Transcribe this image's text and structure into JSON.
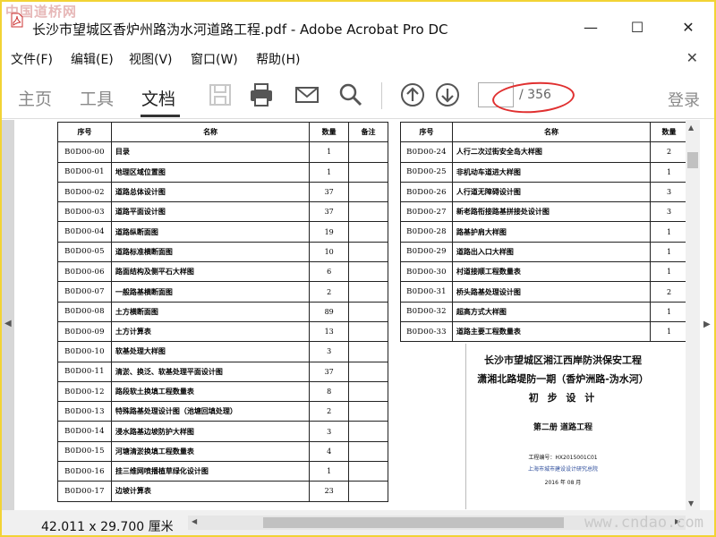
{
  "watermarks": {
    "top": "中国道桥网",
    "bottom": "www.cndao.com"
  },
  "window": {
    "title": "长沙市望城区香炉州路沩水河道路工程.pdf - Adobe Acrobat Pro DC",
    "minimize": "—",
    "maximize": "☐",
    "close": "✕"
  },
  "menu": {
    "items": [
      "文件(F)",
      "编辑(E)",
      "视图(V)",
      "窗口(W)",
      "帮助(H)"
    ],
    "close": "✕"
  },
  "toolbar": {
    "tabs": [
      "主页",
      "工具",
      "文档"
    ],
    "active_tab": "文档",
    "icons": [
      "save-icon",
      "print-icon",
      "email-icon",
      "search-icon",
      "page-up-icon",
      "page-down-icon"
    ],
    "page_value": "",
    "page_total": "/ 356",
    "login": "登录"
  },
  "document": {
    "left_table": {
      "headers": [
        "序号",
        "名称",
        "数量",
        "备注"
      ],
      "rows": [
        {
          "code": "B0D00-00",
          "name": "目录",
          "qty": "1"
        },
        {
          "code": "B0D00-01",
          "name": "地理区域位置图",
          "qty": "1"
        },
        {
          "code": "B0D00-02",
          "name": "道路总体设计图",
          "qty": "37"
        },
        {
          "code": "B0D00-03",
          "name": "道路平面设计图",
          "qty": "37"
        },
        {
          "code": "B0D00-04",
          "name": "道路纵断面图",
          "qty": "19"
        },
        {
          "code": "B0D00-05",
          "name": "道路标准横断面图",
          "qty": "10"
        },
        {
          "code": "B0D00-06",
          "name": "路面结构及侧平石大样图",
          "qty": "6"
        },
        {
          "code": "B0D00-07",
          "name": "一般路基横断面图",
          "qty": "2"
        },
        {
          "code": "B0D00-08",
          "name": "土方横断面图",
          "qty": "89"
        },
        {
          "code": "B0D00-09",
          "name": "土方计算表",
          "qty": "13"
        },
        {
          "code": "B0D00-10",
          "name": "软基处理大样图",
          "qty": "3"
        },
        {
          "code": "B0D00-11",
          "name": "清淤、换泛、软基处理平面设计图",
          "qty": "37"
        },
        {
          "code": "B0D00-12",
          "name": "路段软土换填工程数量表",
          "qty": "8"
        },
        {
          "code": "B0D00-13",
          "name": "特殊路基处理设计图（池塘回填处理）",
          "qty": "2"
        },
        {
          "code": "B0D00-14",
          "name": "浸水路基边坡防护大样图",
          "qty": "3"
        },
        {
          "code": "B0D00-15",
          "name": "河塘清淤换填工程数量表",
          "qty": "4"
        },
        {
          "code": "B0D00-16",
          "name": "挂三维网喷播植草绿化设计图",
          "qty": "1"
        },
        {
          "code": "B0D00-17",
          "name": "边坡计算表",
          "qty": "23"
        }
      ]
    },
    "right_table": {
      "headers": [
        "序号",
        "名称",
        "数量"
      ],
      "rows": [
        {
          "code": "B0D00-24",
          "name": "人行二次过街安全岛大样图",
          "qty": "2"
        },
        {
          "code": "B0D00-25",
          "name": "非机动车道进大样图",
          "qty": "1"
        },
        {
          "code": "B0D00-26",
          "name": "人行道无障碍设计图",
          "qty": "3"
        },
        {
          "code": "B0D00-27",
          "name": "新老路衔接路基拼接处设计图",
          "qty": "3"
        },
        {
          "code": "B0D00-28",
          "name": "路基护肩大样图",
          "qty": "1"
        },
        {
          "code": "B0D00-29",
          "name": "道路出入口大样图",
          "qty": "1"
        },
        {
          "code": "B0D00-30",
          "name": "村道接顺工程数量表",
          "qty": "1"
        },
        {
          "code": "B0D00-31",
          "name": "桥头路基处理设计图",
          "qty": "2"
        },
        {
          "code": "B0D00-32",
          "name": "超高方式大样图",
          "qty": "1"
        },
        {
          "code": "B0D00-33",
          "name": "道路主要工程数量表",
          "qty": "1"
        }
      ]
    },
    "cover": {
      "line1": "长沙市望城区湘江西岸防洪保安工程",
      "line2": "潇湘北路堤防一期（香炉洲路-沩水河）",
      "line3": "初 步 设 计",
      "line4": "第二册  道路工程",
      "line5": "工程编号：HX2015001C01",
      "line6": "上海市城市建设设计研究总院",
      "line7": "2016 年 08 月"
    }
  },
  "status": {
    "page_size": "42.011 x 29.700 厘米"
  }
}
